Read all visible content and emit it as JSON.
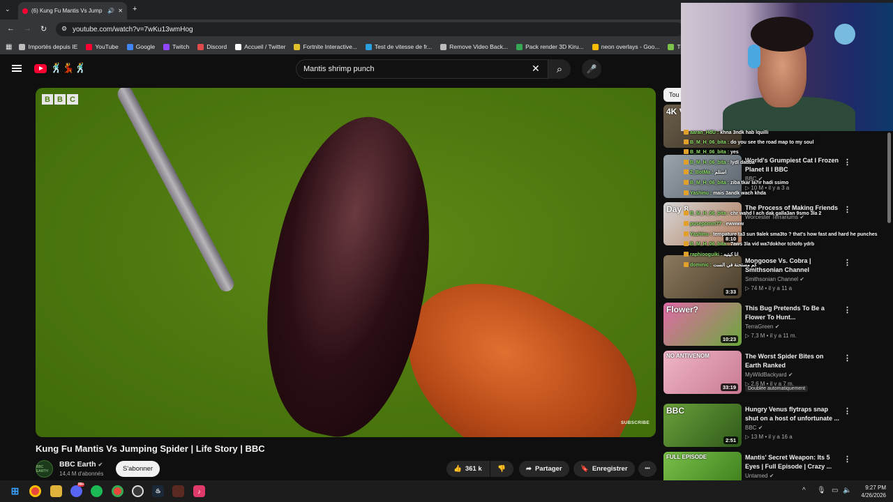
{
  "browser": {
    "tab_title": "(6) Kung Fu Mantis Vs Jump",
    "new_tab": "+",
    "url": "youtube.com/watch?v=7wKu13wmHog",
    "bookmarks": [
      {
        "label": "Importés depuis IE",
        "color": "#bdbdbd"
      },
      {
        "label": "YouTube",
        "color": "#ff0033"
      },
      {
        "label": "Google",
        "color": "#4285f4"
      },
      {
        "label": "Twitch",
        "color": "#9146ff"
      },
      {
        "label": "Discord",
        "color": "#e04b4b"
      },
      {
        "label": "Accueil / Twitter",
        "color": "#ffffff"
      },
      {
        "label": "Fortnite Interactive...",
        "color": "#e0c02a"
      },
      {
        "label": "Test de vitesse de fr...",
        "color": "#2aa0e0"
      },
      {
        "label": "Remove Video Back...",
        "color": "#bdbdbd"
      },
      {
        "label": "Pack render 3D Kiru...",
        "color": "#34a853"
      },
      {
        "label": "neon overlays - Goo...",
        "color": "#fbbc04"
      },
      {
        "label": "Téléch",
        "color": "#7cc24a"
      }
    ]
  },
  "youtube": {
    "search_query": "Mantis shrimp punch",
    "video": {
      "title": "Kung Fu Mantis Vs Jumping Spider | Life Story | BBC",
      "watermark_letters": [
        "B",
        "B",
        "C"
      ],
      "subscribe_watermark": "SUBSCRIBE"
    },
    "channel": {
      "avatar_text": "BBC EARTH",
      "name": "BBC Earth",
      "verified": "✔",
      "subscribers": "14,4 M d'abonnés",
      "subscribe_label": "S'abonner"
    },
    "actions": {
      "likes": "361 k",
      "share": "Partager",
      "save": "Enregistrer",
      "more": "•••"
    },
    "chip": "Tou",
    "recommendations": [
      {
        "title": "",
        "channel": "",
        "meta": "",
        "duration": "",
        "thumb_label": "4K VIDEO",
        "colors": [
          "#6b5e4a",
          "#3a3226"
        ]
      },
      {
        "title": "World's Grumpiest Cat I Frozen Planet II I BBC",
        "channel": "BBC",
        "meta": "10 M • il y a 3 a",
        "duration": "",
        "thumb_label": "",
        "colors": [
          "#9aa4ad",
          "#5a636b"
        ]
      },
      {
        "title": "The Process of Making Friends",
        "channel": "Worcester Terrariums",
        "meta": "",
        "duration": "8:10",
        "thumb_label": "Day 8",
        "colors": [
          "#d6d6d6",
          "#b07a5a"
        ]
      },
      {
        "title": "Mongoose Vs. Cobra | Smithsonian Channel",
        "channel": "Smithsonian Channel",
        "meta": "74 M • il y a 11 a",
        "duration": "3:33",
        "thumb_label": "",
        "colors": [
          "#8c7a5e",
          "#4a3e2c"
        ]
      },
      {
        "title": "This Bug Pretends To Be a Flower To Hunt...",
        "channel": "TerraGreen",
        "meta": "7,3 M • il y a 11 m.",
        "duration": "10:23",
        "thumb_label": "Flower?",
        "colors": [
          "#e26aa8",
          "#6aa83a"
        ]
      },
      {
        "title": "The Worst Spider Bites on Earth Ranked",
        "channel": "MyWildBackyard",
        "meta": "2,6 M • il y a 7 m.",
        "duration": "33:19",
        "thumb_label": "NO ANTIVENOM",
        "colors": [
          "#f0b6c8",
          "#c87a90"
        ],
        "badge": "Doublée automatiquement"
      },
      {
        "title": "Hungry Venus flytraps snap shut on a host of unfortunate ...",
        "channel": "BBC",
        "meta": "13 M • il y a 16 a",
        "duration": "2:51",
        "thumb_label": "BBC",
        "colors": [
          "#6aa03a",
          "#2e5a1a"
        ]
      },
      {
        "title": "Mantis' Secret Weapon: Its 5 Eyes | Full Episode | Crazy ...",
        "channel": "Untamed",
        "meta": "",
        "duration": "",
        "thumb_label": "FULL EPISODE",
        "colors": [
          "#7ac04a",
          "#3a7a1a"
        ]
      }
    ]
  },
  "stream_overlay": {
    "chat": [
      {
        "user": "aaran_HdU :",
        "msg": "khna 3ndk hab lquilli"
      },
      {
        "user": "B_M_H_06_bita :",
        "msg": "do you see the road map to my soul"
      },
      {
        "user": "B_M_H_06_bita :",
        "msg": "yes"
      },
      {
        "user": "B_M_H_06_bita :",
        "msg": "lydl dadba"
      },
      {
        "user": "2_BotMa :",
        "msg": "استلم"
      },
      {
        "user": "B_M_H_06_bita :",
        "msg": "ziba tkar la7ir hadi ssimo"
      },
      {
        "user": "Yashinu :",
        "msg": "mais 3andk wach khda"
      },
      {
        "user": "B_M_H_06_bita :",
        "msg": "chr wahd l ach dak galla3an 9smo 3la 2"
      },
      {
        "user": "pusepomm77 :",
        "msg": "ewwww"
      },
      {
        "user": "Yashinu :",
        "msg": "tempature ta3 sun 9alek sma3to ? that's how fast and hard he punches"
      },
      {
        "user": "B_M_H_06_bita :",
        "msg": "7aws 3la vid wa7dokhor tchofo ydrb"
      },
      {
        "user": "raphiooguiki :",
        "msg": "انا كيتيه"
      },
      {
        "user": "dominic :",
        "msg": "كم مستحنة في الست"
      }
    ]
  },
  "taskbar": {
    "time": "9:27 PM",
    "date": "4/26/2026",
    "discord_badge": "99+"
  }
}
